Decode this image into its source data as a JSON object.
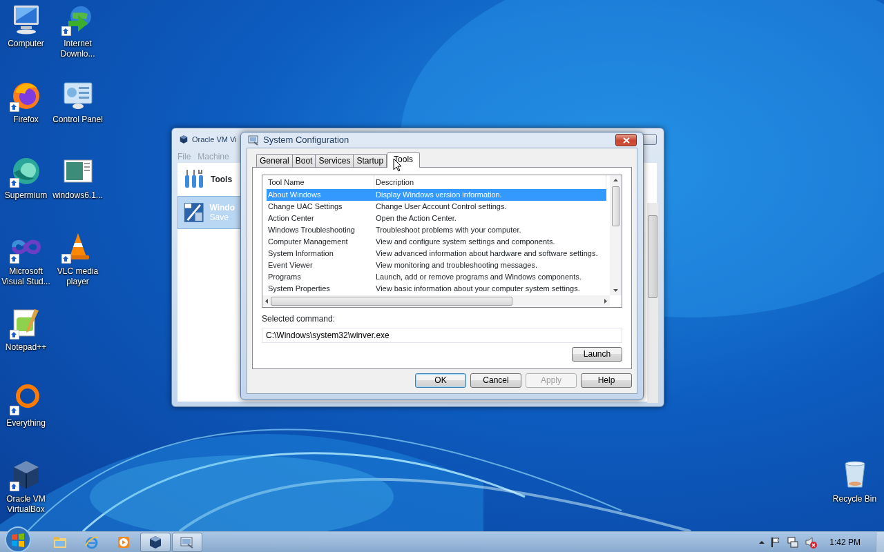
{
  "desktop_icons": [
    {
      "label": "Computer",
      "kind": "computer",
      "shortcut": false
    },
    {
      "label": "Firefox",
      "kind": "firefox",
      "shortcut": true
    },
    {
      "label": "Supermium",
      "kind": "supermium",
      "shortcut": true
    },
    {
      "label": "Microsoft Visual Stud...",
      "kind": "visualstudio",
      "shortcut": true
    },
    {
      "label": "Notepad++",
      "kind": "notepad",
      "shortcut": true
    },
    {
      "label": "Everything",
      "kind": "everything",
      "shortcut": true
    },
    {
      "label": "Oracle VM VirtualBox",
      "kind": "virtualbox",
      "shortcut": true
    },
    {
      "label": "Internet Downlo...",
      "kind": "downloader",
      "shortcut": true
    },
    {
      "label": "Control Panel",
      "kind": "controlpanel",
      "shortcut": false
    },
    {
      "label": "windows6.1...",
      "kind": "document",
      "shortcut": false
    },
    {
      "label": "VLC media player",
      "kind": "vlc",
      "shortcut": true
    }
  ],
  "recycle_bin": {
    "label": "Recycle Bin"
  },
  "virtualbox_window": {
    "title": "Oracle VM Vi",
    "menu": [
      "File",
      "Machine"
    ],
    "items": [
      {
        "label": "Tools",
        "kind": "tools",
        "selected": false
      },
      {
        "label": "Windo",
        "status": "Save",
        "kind": "vm",
        "selected": true
      }
    ]
  },
  "dialog": {
    "title": "System Configuration",
    "tabs": [
      {
        "label": "General",
        "selected": false
      },
      {
        "label": "Boot",
        "selected": false
      },
      {
        "label": "Services",
        "selected": false
      },
      {
        "label": "Startup",
        "selected": false
      },
      {
        "label": "Tools",
        "selected": true
      }
    ],
    "table": {
      "columns": [
        "Tool Name",
        "Description"
      ],
      "rows": [
        {
          "name": "About Windows",
          "description": "Display Windows version information.",
          "selected": true
        },
        {
          "name": "Change UAC Settings",
          "description": "Change User Account Control settings.",
          "selected": false
        },
        {
          "name": "Action Center",
          "description": "Open the Action Center.",
          "selected": false
        },
        {
          "name": "Windows Troubleshooting",
          "description": "Troubleshoot problems with your computer.",
          "selected": false
        },
        {
          "name": "Computer Management",
          "description": "View and configure system settings and components.",
          "selected": false
        },
        {
          "name": "System Information",
          "description": "View advanced information about hardware and software settings.",
          "selected": false
        },
        {
          "name": "Event Viewer",
          "description": "View monitoring and troubleshooting messages.",
          "selected": false
        },
        {
          "name": "Programs",
          "description": "Launch, add or remove programs and Windows components.",
          "selected": false
        },
        {
          "name": "System Properties",
          "description": "View basic information about your computer system settings.",
          "selected": false
        }
      ]
    },
    "command_label": "Selected command:",
    "command": "C:\\Windows\\system32\\winver.exe",
    "launch": "Launch",
    "buttons": [
      {
        "label": "OK",
        "default": true,
        "disabled": false
      },
      {
        "label": "Cancel",
        "default": false,
        "disabled": false
      },
      {
        "label": "Apply",
        "default": false,
        "disabled": true
      },
      {
        "label": "Help",
        "default": false,
        "disabled": false
      }
    ]
  },
  "taskbar": {
    "items": [
      {
        "kind": "explorer",
        "active": false
      },
      {
        "kind": "ie",
        "active": false
      },
      {
        "kind": "media",
        "active": false
      },
      {
        "kind": "virtualbox",
        "active": true
      },
      {
        "kind": "msconfig",
        "active": true
      }
    ],
    "clock": "1:42 PM"
  }
}
